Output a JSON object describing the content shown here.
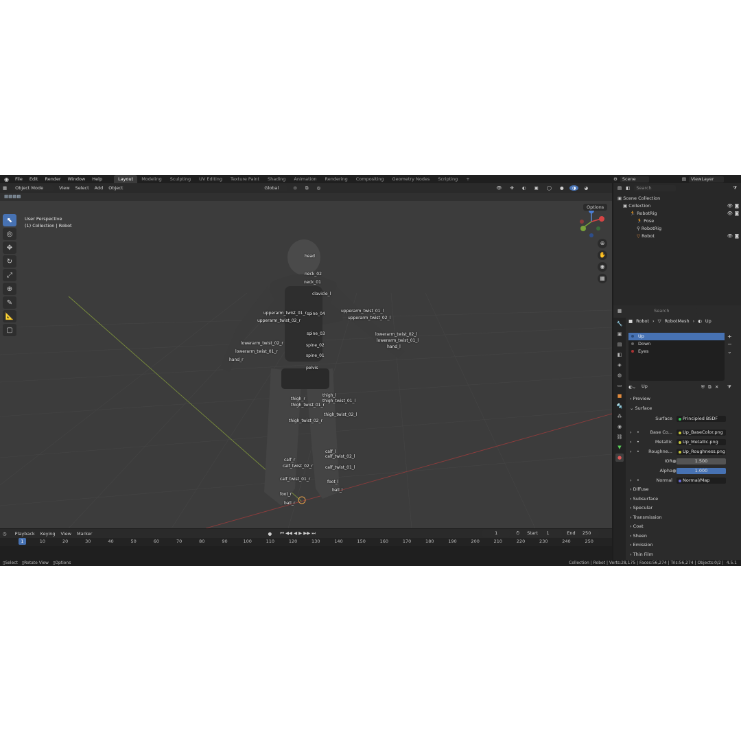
{
  "menu": [
    "File",
    "Edit",
    "Render",
    "Window",
    "Help"
  ],
  "workspaces": [
    "Layout",
    "Modeling",
    "Sculpting",
    "UV Editing",
    "Texture Paint",
    "Shading",
    "Animation",
    "Rendering",
    "Compositing",
    "Geometry Nodes",
    "Scripting",
    "+"
  ],
  "scene": {
    "name": "Scene",
    "view_layer": "ViewLayer"
  },
  "viewport": {
    "mode": "Object Mode",
    "menus": [
      "View",
      "Select",
      "Add",
      "Object"
    ],
    "transform": "Global",
    "options": "Options",
    "perspective": "User Perspective",
    "collection_info": "(1) Collection | Robot",
    "bones": [
      "head",
      "neck_02",
      "neck_01",
      "clavicle_l",
      "spine_04",
      "upperarm_twist_01_r",
      "upperarm_twist_02_r",
      "upperarm_twist_01_l",
      "upperarm_twist_02_l",
      "spine_03",
      "spine_02",
      "spine_01",
      "lowerarm_twist_02_r",
      "lowerarm_twist_01_r",
      "lowerarm_twist_02_l",
      "lowerarm_twist_01_l",
      "hand_r",
      "hand_l",
      "pelvis",
      "thigh_r",
      "thigh_l",
      "thigh_twist_01_r",
      "thigh_twist_01_l",
      "thigh_twist_02_r",
      "thigh_twist_02_l",
      "calf_r",
      "calf_l",
      "calf_twist_02_r",
      "calf_twist_02_l",
      "calf_twist_01_r",
      "calf_twist_01_l",
      "foot_r",
      "foot_l",
      "ball_r",
      "ball_l"
    ]
  },
  "outliner": {
    "search_placeholder": "Search",
    "root": "Scene Collection",
    "items": [
      {
        "label": "Collection",
        "indent": 0
      },
      {
        "label": "RobotRig",
        "indent": 1
      },
      {
        "label": "Pose",
        "indent": 2
      },
      {
        "label": "RobotRig",
        "indent": 2
      },
      {
        "label": "Robot",
        "indent": 2
      }
    ]
  },
  "properties": {
    "search_placeholder": "Search",
    "breadcrumb": [
      "Robot",
      "RobotMesh",
      "Up"
    ],
    "slots": [
      "Up",
      "Down",
      "Eyes"
    ],
    "material_name": "Up",
    "sections_top": [
      "Preview",
      "Surface"
    ],
    "surface": {
      "label": "Surface",
      "value": "Principled BSDF"
    },
    "inputs": [
      {
        "label": "Base Co...",
        "value": "Up_BaseColor.png",
        "color": "#c8c83a"
      },
      {
        "label": "Metallic",
        "value": "Up_Metallic.png",
        "color": "#c8c83a"
      },
      {
        "label": "Roughne...",
        "value": "Up_Roughness.png",
        "color": "#c8c83a"
      }
    ],
    "ior": {
      "label": "IOR",
      "value": "1.500"
    },
    "alpha": {
      "label": "Alpha",
      "value": "1.000"
    },
    "normal": {
      "label": "Normal",
      "value": "Normal/Map"
    },
    "sections": [
      "Diffuse",
      "Subsurface",
      "Specular",
      "Transmission",
      "Coat",
      "Sheen",
      "Emission",
      "Thin Film"
    ]
  },
  "timeline": {
    "menus": [
      "Playback",
      "Keying",
      "View",
      "Marker"
    ],
    "current_frame": "1",
    "start_label": "Start",
    "start": "1",
    "end_label": "End",
    "end": "250",
    "ticks": [
      "1",
      "10",
      "20",
      "30",
      "40",
      "50",
      "60",
      "70",
      "80",
      "90",
      "100",
      "110",
      "120",
      "130",
      "140",
      "150",
      "160",
      "170",
      "180",
      "190",
      "200",
      "210",
      "220",
      "230",
      "240",
      "250"
    ]
  },
  "status": {
    "left": [
      "Select",
      "Rotate View",
      "Options"
    ],
    "right": "Collection | Robot | Verts:28,175 | Faces:56,274 | Tris:56,274 | Objects:0/2 |",
    "version": "4.5.1"
  },
  "colors": {
    "accent": "#4772b3",
    "grid": "#3c3c3c"
  }
}
